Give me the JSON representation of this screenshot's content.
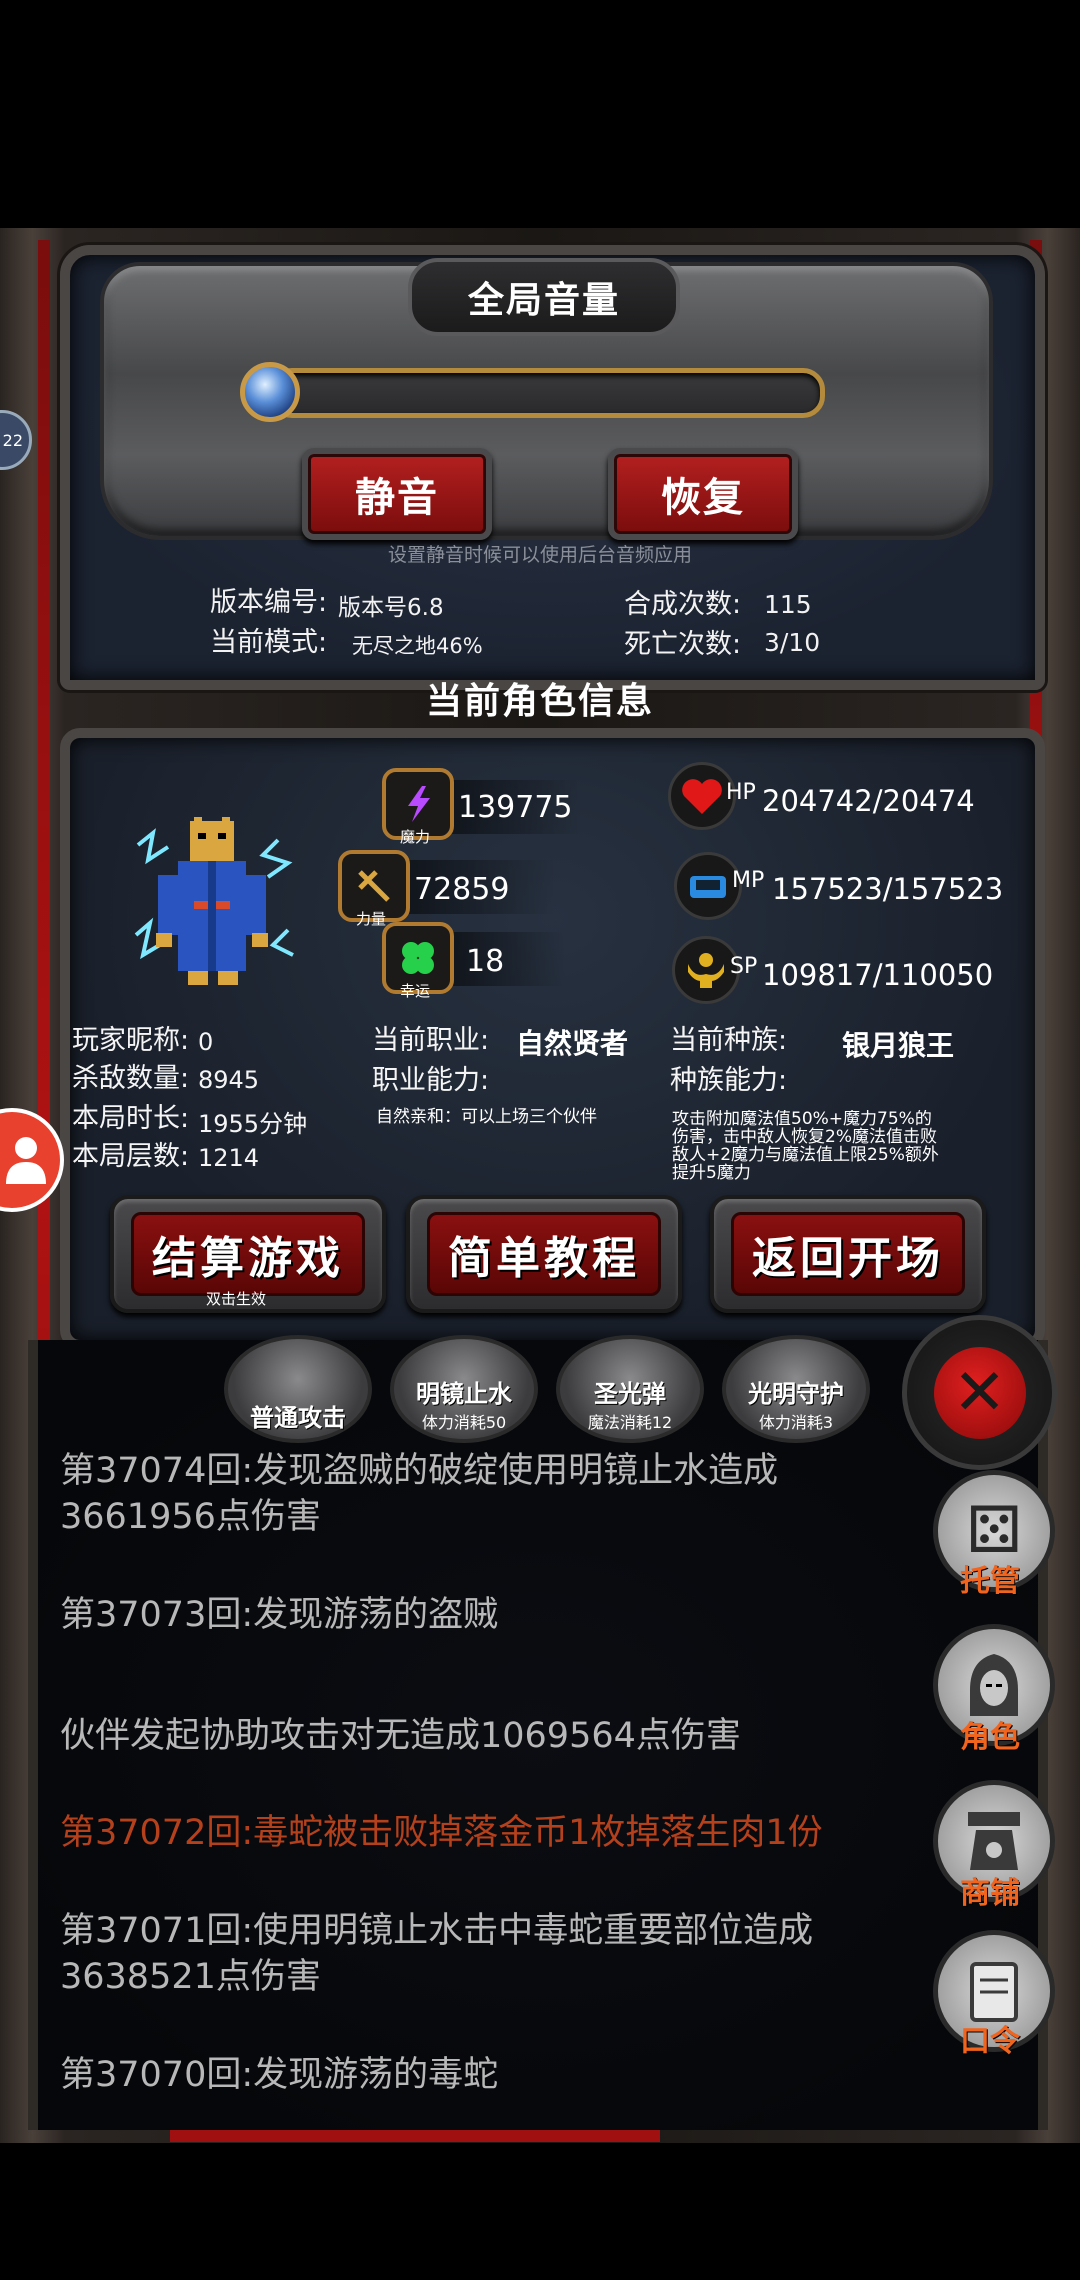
{
  "volume": {
    "title": "全局音量",
    "mute_label": "静音",
    "restore_label": "恢复",
    "hint": "设置静音时候可以使用后台音频应用"
  },
  "game_info": {
    "version_label": "版本编号:",
    "version_value": "版本号6.8",
    "mode_label": "当前模式:",
    "mode_value": "无尽之地46%",
    "craft_label": "合成次数:",
    "craft_value": "115",
    "death_label": "死亡次数:",
    "death_value": "3/10"
  },
  "character": {
    "section_title": "当前角色信息",
    "magic": {
      "value": "139775",
      "caption": "魔力"
    },
    "strength": {
      "value": "72859",
      "caption": "力量"
    },
    "luck": {
      "value": "18",
      "caption": "幸运"
    },
    "hp": {
      "label": "HP",
      "value": "204742/20474:"
    },
    "mp": {
      "label": "MP",
      "value": "157523/157523"
    },
    "sp": {
      "label": "SP",
      "value": "109817/110050"
    },
    "nickname_label": "玩家昵称:",
    "nickname_value": "0",
    "kills_label": "杀敌数量:",
    "kills_value": "8945",
    "duration_label": "本局时长:",
    "duration_value": "1955分钟",
    "floor_label": "本局层数:",
    "floor_value": "1214",
    "job_label": "当前职业:",
    "job_value": "自然贤者",
    "job_ability_label": "职业能力:",
    "job_ability_value": "自然亲和：可以上场三个伙伴",
    "race_label": "当前种族:",
    "race_value": "银月狼王",
    "race_ability_label": "种族能力:",
    "race_ability_value": "攻击附加魔法值50%+魔力75%的伤害，击中敌人恢复2%魔法值击败敌人+2魔力与魔法值上限25%额外提升5魔力"
  },
  "actions": {
    "settle_label": "结算游戏",
    "settle_sub": "双击生效",
    "tutorial_label": "简单教程",
    "back_label": "返回开场"
  },
  "skills": [
    {
      "name": "普通攻击",
      "cost": ""
    },
    {
      "name": "明镜止水",
      "cost": "体力消耗50"
    },
    {
      "name": "圣光弹",
      "cost": "魔法消耗12"
    },
    {
      "name": "光明守护",
      "cost": "体力消耗3"
    }
  ],
  "log": [
    {
      "text": "第37074回:发现盗贼的破绽使用明镜止水造成3661956点伤害",
      "type": "normal"
    },
    {
      "text": "第37073回:发现游荡的盗贼",
      "type": "normal"
    },
    {
      "text": "伙伴发起协助攻击对无造成1069564点伤害",
      "type": "normal"
    },
    {
      "text": "第37072回:毒蛇被击败掉落金币1枚掉落生肉1份",
      "type": "red"
    },
    {
      "text": "第37071回:使用明镜止水击中毒蛇重要部位造成3638521点伤害",
      "type": "normal"
    },
    {
      "text": "第37070回:发现游荡的毒蛇",
      "type": "normal"
    }
  ],
  "side_menu": {
    "auto_label": "托管",
    "role_label": "角色",
    "shop_label": "商铺",
    "code_label": "口令"
  },
  "float_badge": "22",
  "colors": {
    "accent_red": "#b01212",
    "log_red": "#b5401c",
    "side_orange": "#f0641e"
  }
}
